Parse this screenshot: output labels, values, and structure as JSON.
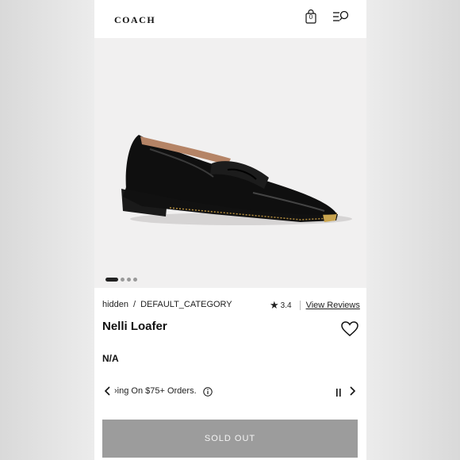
{
  "header": {
    "logo": "COACH",
    "bag_count": "0",
    "bag_icon": "shopping-bag-icon",
    "menu_icon": "menu-search-icon"
  },
  "gallery": {
    "image_description": "black leather loafer",
    "dots": [
      true,
      false,
      false,
      false
    ]
  },
  "breadcrumb": {
    "items": [
      "hidden",
      "DEFAULT_CATEGORY"
    ],
    "separator": "/"
  },
  "rating": {
    "value": "3.4",
    "reviews_link": "View Reviews"
  },
  "product": {
    "title": "Nelli Loafer",
    "price": "N/A"
  },
  "promo": {
    "text": "›ing On $75+ Orders."
  },
  "cta": {
    "label": "SOLD OUT"
  },
  "colors": {
    "cta_background": "#9c9c9c",
    "hero_background": "#f1f0f0"
  }
}
